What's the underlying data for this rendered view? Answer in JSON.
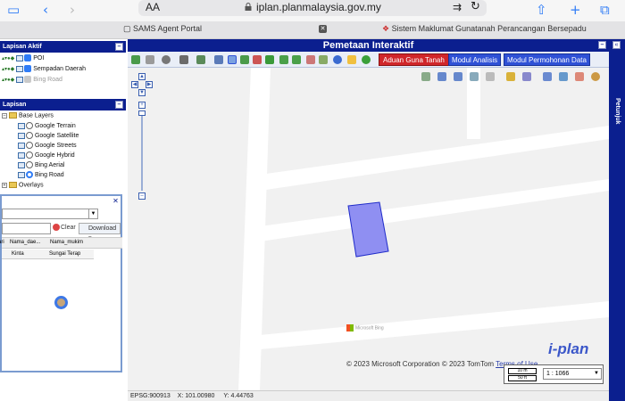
{
  "browser": {
    "aa_label": "AA",
    "url": "iplan.planmalaysia.gov.my",
    "tabs": [
      {
        "label": "SAMS Agent Portal"
      },
      {
        "label": "Sistem Maklumat Gunatanah Perancangan Bersepadu"
      }
    ]
  },
  "left_panel": {
    "active_layers_title": "Lapisan Aktif",
    "active_layers": [
      {
        "label": "POI",
        "checked": true
      },
      {
        "label": "Sempadan Daerah",
        "checked": true
      },
      {
        "label": "Bing Road",
        "checked": false
      }
    ],
    "layers_title": "Lapisan",
    "base_layers_label": "Base Layers",
    "base_layers": [
      {
        "label": "Google Terrain",
        "selected": false
      },
      {
        "label": "Google Satellite",
        "selected": false
      },
      {
        "label": "Google Streets",
        "selected": false
      },
      {
        "label": "Google Hybrid",
        "selected": false
      },
      {
        "label": "Bing Aerial",
        "selected": false
      },
      {
        "label": "Bing Road",
        "selected": true
      }
    ],
    "overlays_label": "Overlays"
  },
  "query_window": {
    "clear_label": "Clear",
    "download_label": "Download",
    "columns": [
      "ari",
      "Nama_dae...",
      "Nama_mukim"
    ],
    "rows": [
      [
        "",
        "Kinta",
        "Sungai Terap"
      ]
    ]
  },
  "main": {
    "title": "Pemetaan Interaktif",
    "buttons": {
      "aduan": "Aduan Guna Tanah",
      "analisis": "Modul Analisis",
      "permohonan": "Modul Permohonan Data"
    },
    "colors": {
      "header": "#0b1f8f",
      "aduan": "#d0262a",
      "module": "#2f51d6",
      "parcel": "#7f86f0"
    }
  },
  "map": {
    "bing_brand": "Microsoft Bing",
    "logo_text": "i-plan",
    "copyright": "© 2023 Microsoft Corporation © 2023 TomTom",
    "terms_label": "Terms of Use",
    "scale_top": "10 m",
    "scale_bottom": "50 ft",
    "scale_value": "1 : 1066"
  },
  "status": {
    "epsg": "EPSG:900913",
    "x": "X: 101.00980",
    "y": "Y: 4.44763"
  },
  "right_panel": {
    "label": "Petunjuk"
  }
}
